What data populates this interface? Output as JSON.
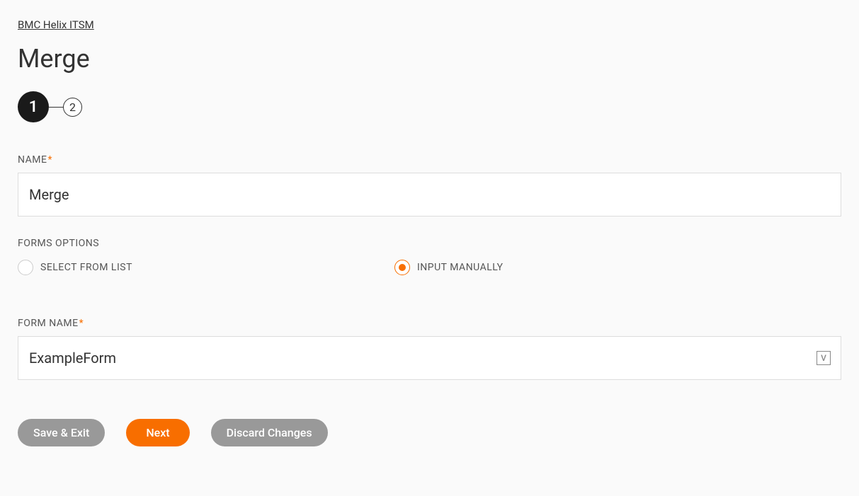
{
  "breadcrumb": {
    "label": "BMC Helix ITSM"
  },
  "page": {
    "title": "Merge"
  },
  "stepper": {
    "steps": [
      "1",
      "2"
    ],
    "active_index": 0
  },
  "form": {
    "name_label": "NAME",
    "name_value": "Merge",
    "forms_options_label": "FORMS OPTIONS",
    "radio_options": [
      {
        "label": "SELECT FROM LIST",
        "selected": false
      },
      {
        "label": "INPUT MANUALLY",
        "selected": true
      }
    ],
    "form_name_label": "FORM NAME",
    "form_name_value": "ExampleForm"
  },
  "buttons": {
    "save_exit": "Save & Exit",
    "next": "Next",
    "discard": "Discard Changes"
  }
}
